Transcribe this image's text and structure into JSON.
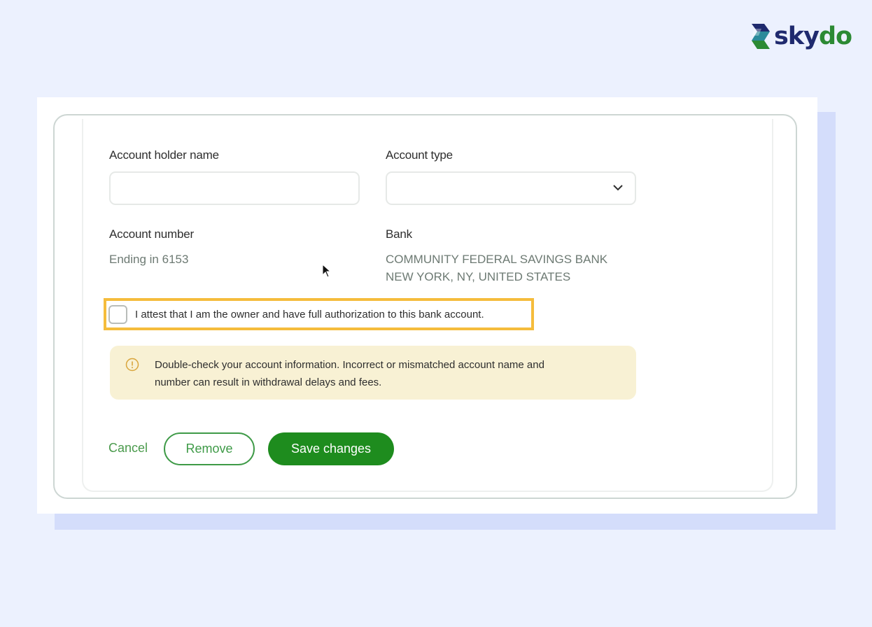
{
  "brand": {
    "name_part1": "sky",
    "name_part2": "do",
    "colors": {
      "navy": "#1f2a6e",
      "green": "#2c8a34"
    }
  },
  "form": {
    "account_holder_name": {
      "label": "Account holder name",
      "value": ""
    },
    "account_type": {
      "label": "Account type",
      "value": ""
    },
    "account_number": {
      "label": "Account number",
      "value": "Ending in 6153"
    },
    "bank": {
      "label": "Bank",
      "name": "COMMUNITY FEDERAL SAVINGS BANK",
      "location": "NEW YORK, NY, UNITED STATES"
    },
    "attestation": {
      "text": "I attest that I am the owner and have full authorization to this bank account.",
      "checked": false,
      "highlight_color": "#f5bc3c"
    },
    "warning": {
      "icon": "exclamation-circle-icon",
      "line1": "Double-check your account information. Incorrect or mismatched account name and",
      "line2": "number can result in withdrawal delays and fees.",
      "background": "#f8f1d4"
    },
    "actions": {
      "cancel_label": "Cancel",
      "remove_label": "Remove",
      "save_label": "Save changes",
      "accent": "#1e8c1e"
    }
  }
}
